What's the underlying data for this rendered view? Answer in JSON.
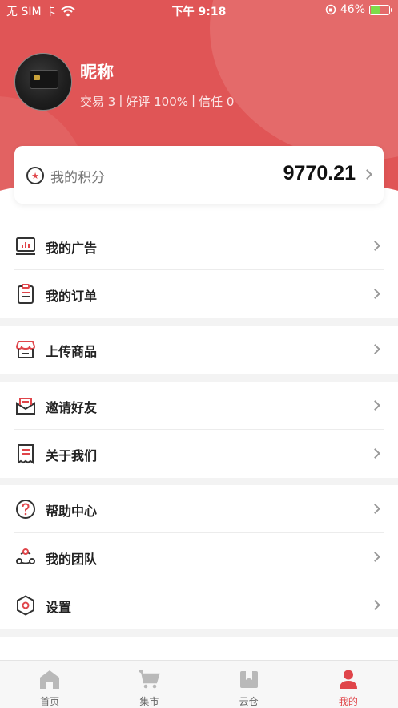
{
  "status_bar": {
    "carrier": "无 SIM 卡",
    "time": "下午 9:18",
    "battery": "46%"
  },
  "profile": {
    "nickname": "昵称",
    "stats": {
      "trades": "交易 3",
      "separator": "|",
      "rating": "好评 100%",
      "trust": "信任 0"
    }
  },
  "points": {
    "label": "我的积分",
    "value": "9770.21"
  },
  "menu": {
    "my_ads": "我的广告",
    "my_orders": "我的订单",
    "upload_goods": "上传商品",
    "invite_friends": "邀请好友",
    "about_us": "关于我们",
    "help_center": "帮助中心",
    "my_team": "我的团队",
    "settings": "设置"
  },
  "tabbar": {
    "home": "首页",
    "market": "集市",
    "cloud_warehouse": "云仓",
    "mine": "我的"
  },
  "colors": {
    "accent": "#e0454a",
    "header": "#e05556",
    "battery": "#7ddb4a"
  },
  "battery_level": 0.46
}
